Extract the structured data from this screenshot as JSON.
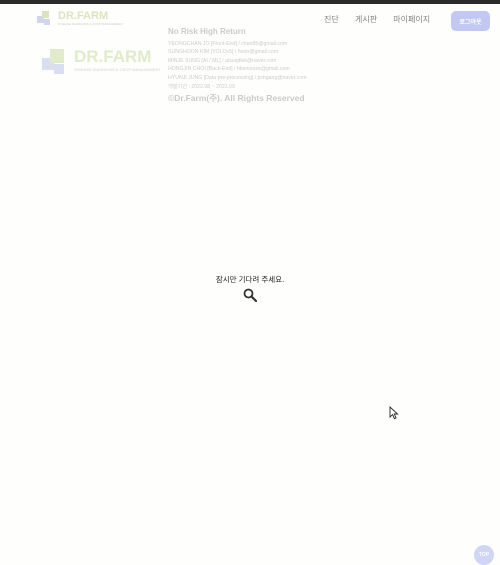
{
  "nav": {
    "logo_text": "DR.FARM",
    "logo_sub": "DISEASE DIAGNOSIS & CROP MANAGEMENT",
    "links": [
      "진단",
      "게시판",
      "마이페이지"
    ],
    "login_label": "로그아웃"
  },
  "footer": {
    "logo_text": "DR.FARM",
    "logo_sub": "DISEASE DIAGNOSIS & CROP MANAGEMENT",
    "title": "No Risk High Return",
    "members": [
      "YEONGCHAN JO [Front-End] / chan85@gmail.com",
      "SUNGHOON KIM [YOLOv5] / hoon@gmail.com",
      "MINJE SUNG [AI / ML] / alsuqdlek@naver.com",
      "HONGJIN CHOI [Back-End] / hbsmooze@gmail.com",
      "HYUNJI JUNG [Data pre-processing] / jcmgang@naver.com"
    ],
    "period": "개발기간 : 2022.08 ~ 2022.09",
    "copyright": "©Dr.Farm(주). All Rights Reserved"
  },
  "loading": {
    "message": "잠시만 기다려 주세요."
  },
  "scroll_top": {
    "label": "TOP"
  },
  "colors": {
    "accent": "#c2c8f2",
    "logo_green": "#9ab84a",
    "logo_blue": "#7f8fd8"
  }
}
